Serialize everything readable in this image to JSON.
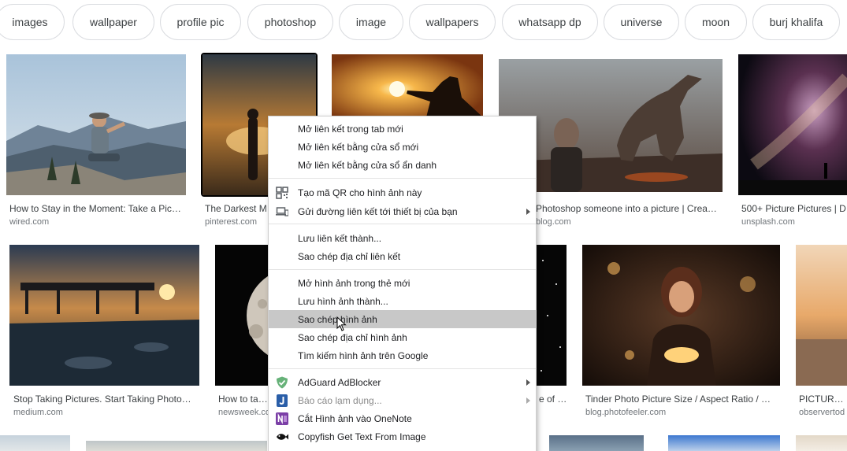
{
  "chips": [
    "images",
    "wallpaper",
    "profile pic",
    "photoshop",
    "image",
    "wallpapers",
    "whatsapp dp",
    "universe",
    "moon",
    "burj khalifa"
  ],
  "row1": [
    {
      "caption": "How to Stay in the Moment: Take a Pic…",
      "site": "wired.com"
    },
    {
      "caption": "The Darkest M",
      "site": "pinterest.com"
    },
    {
      "caption": "",
      "site": ""
    },
    {
      "caption": "Photoshop someone into a picture | Crea…",
      "site": "blog.com"
    },
    {
      "caption": "500+ Picture Pictures | D",
      "site": "unsplash.com"
    }
  ],
  "row2": [
    {
      "caption": "Stop Taking Pictures. Start Taking Photo…",
      "site": "medium.com"
    },
    {
      "caption": "How to take",
      "site": "newsweek.co"
    },
    {
      "caption": "e of …",
      "site": ""
    },
    {
      "caption": "Tinder Photo Picture Size / Aspect Ratio / …",
      "site": "blog.photofeeler.com"
    },
    {
      "caption": "PICTURE TH",
      "site": "observertod"
    }
  ],
  "menu": {
    "open_new_tab": "Mở liên kết trong tab mới",
    "open_new_window": "Mở liên kết bằng cửa sổ mới",
    "open_incognito": "Mở liên kết bằng cửa sổ ẩn danh",
    "create_qr": "Tạo mã QR cho hình ảnh này",
    "send_to_device": "Gửi đường liên kết tới thiết bị của bạn",
    "save_link_as": "Lưu liên kết thành...",
    "copy_link_address": "Sao chép địa chỉ liên kết",
    "open_image_new_tab": "Mở hình ảnh trong thẻ mới",
    "save_image_as": "Lưu hình ảnh thành...",
    "copy_image": "Sao chép hình ảnh",
    "copy_image_address": "Sao chép địa chỉ hình ảnh",
    "search_google_image": "Tìm kiếm hình ảnh trên Google",
    "adguard": "AdGuard AdBlocker",
    "report_abuse": "Báo cáo lạm dụng...",
    "onenote": "Cắt Hình ảnh vào OneNote",
    "copyfish": "Copyfish Get Text From Image"
  },
  "colors": {
    "highlight": "#c8c8c8",
    "adguard_green": "#67b279",
    "onenote_purple": "#7b3fa6",
    "report_blue": "#2a5ea8"
  }
}
